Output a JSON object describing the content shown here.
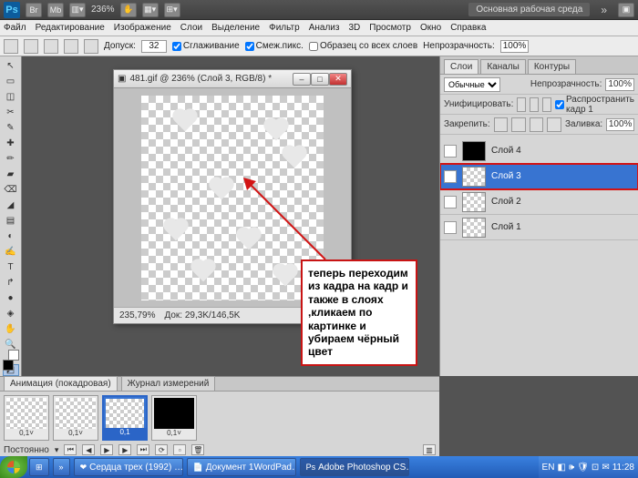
{
  "topbar": {
    "zoom": "236%",
    "workspace": "Основная рабочая среда"
  },
  "menu": [
    "Файл",
    "Редактирование",
    "Изображение",
    "Слои",
    "Выделение",
    "Фильтр",
    "Анализ",
    "3D",
    "Просмотр",
    "Окно",
    "Справка"
  ],
  "options": {
    "tolerance_label": "Допуск:",
    "tolerance": "32",
    "antialias": "Сглаживание",
    "contiguous": "Смеж.пикс.",
    "alllayers": "Образец со всех слоев",
    "opacity_label": "Непрозрачность:",
    "opacity": "100%"
  },
  "tools": [
    "↖",
    "▭",
    "◫",
    "✂",
    "✎",
    "✚",
    "✏",
    "▰",
    "⌫",
    "◢",
    "▤",
    "◐",
    "✍",
    "◑",
    "◒",
    "●",
    "◈",
    "↱",
    "✋",
    "🔍",
    "T",
    "◩"
  ],
  "document": {
    "title": "481.gif @ 236% (Слой 3, RGB/8) *",
    "status_zoom": "235,79%",
    "status_doc": "Док: 29,3K/146,5K"
  },
  "layers_panel": {
    "tabs": [
      "Слои",
      "Каналы",
      "Контуры"
    ],
    "blend": "Обычные",
    "opacity_label": "Непрозрачность:",
    "opacity": "100%",
    "unify": "Унифицировать:",
    "propagate": "Распространить кадр 1",
    "lock_label": "Закрепить:",
    "fill_label": "Заливка:",
    "fill": "100%",
    "layers": [
      {
        "name": "Слой 4",
        "black": true
      },
      {
        "name": "Слой 3",
        "selected": true
      },
      {
        "name": "Слой 2"
      },
      {
        "name": "Слой 1"
      }
    ]
  },
  "animation": {
    "tabs": [
      "Анимация (покадровая)",
      "Журнал измерений"
    ],
    "frames": [
      "0,1˅",
      "0,1˅",
      "0,1",
      "0,1˅"
    ],
    "loop": "Постоянно"
  },
  "taskbar": {
    "items": [
      "Сердца трех (1992) …",
      "Документ 1WordPad…",
      "Adobe Photoshop CS…"
    ],
    "lang": "EN",
    "time": "11:28"
  },
  "callout": "теперь переходим из кадра на кадр и также в слоях ,кликаем по картинке и убираем чёрный цвет"
}
